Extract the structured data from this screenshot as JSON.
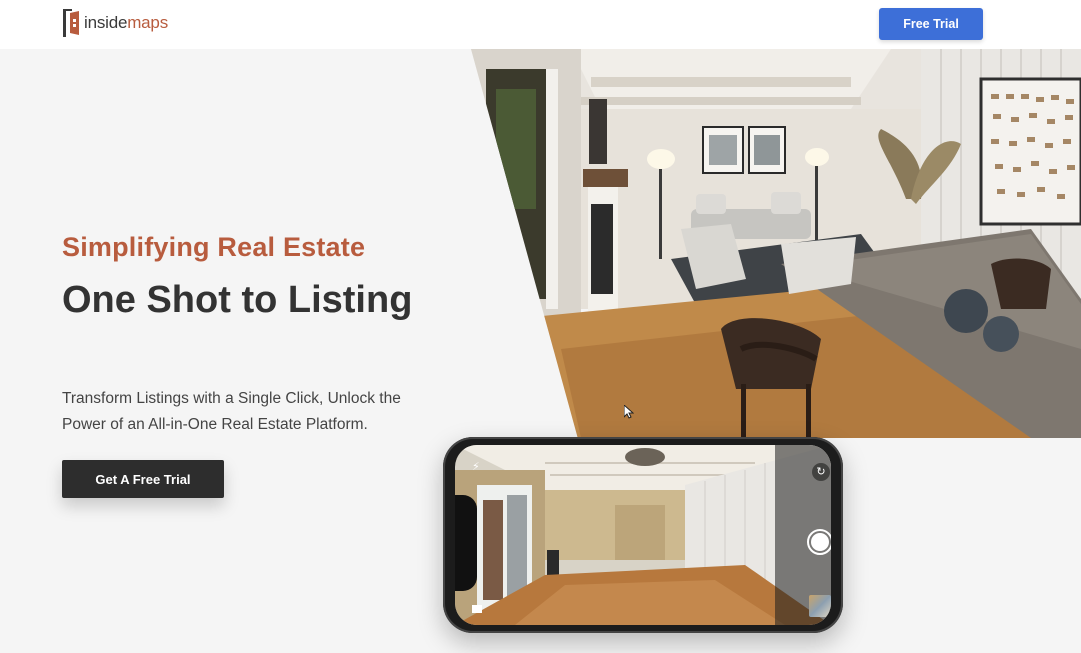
{
  "header": {
    "logo_inside": "inside",
    "logo_maps": "maps",
    "free_trial_label": "Free Trial"
  },
  "hero": {
    "kicker": "Simplifying Real Estate",
    "title": "One Shot to Listing",
    "description": "Transform Listings with a Single Click, Unlock the Power of an All-in-One Real Estate Platform.",
    "cta_label": "Get A Free Trial"
  },
  "phone": {
    "icons": [
      "flash-off-icon",
      "rotate-camera-icon",
      "shutter-button",
      "gallery-thumbnail",
      "mode-icon"
    ]
  },
  "colors": {
    "accent_orange": "#b85c3e",
    "button_blue": "#3d6fd8",
    "button_dark": "#2d2d2d",
    "background": "#f5f5f5"
  }
}
